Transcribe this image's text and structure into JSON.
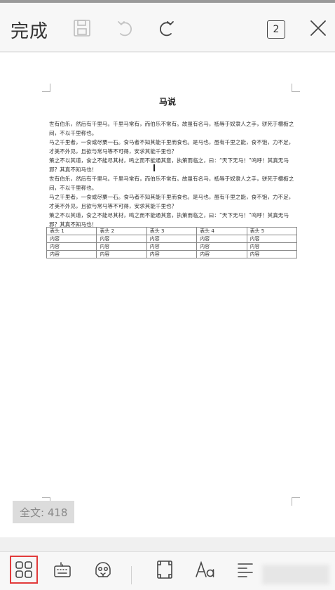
{
  "topbar": {
    "done_label": "完成",
    "page_count": "2",
    "icons": [
      "save-icon",
      "undo-icon",
      "redo-icon",
      "close-icon"
    ]
  },
  "document": {
    "title": "马说",
    "paragraphs": [
      "世有伯乐，然后有千里马。千里马常有，而伯乐不常有。故虽有名马，祗辱于奴隶人之手，骈死于槽枥之间，不以千里称也。",
      "马之千里者，一食或尽粟一石。食马者不知其能千里而食也。是马也，虽有千里之能，食不饱，力不足，才美不外见，且欲与常马等不可得，安求其能千里也？",
      "策之不以其道，食之不能尽其材，鸣之而不能通其意，执策而临之，曰：“天下无马！”呜呼！其真无马邪？其真不知马也！",
      " 世有伯乐，然后有千里马。千里马常有，而伯乐不常有。故虽有名马，祗辱于奴隶人之手，骈死于槽枥之间，不以千里称也。",
      "马之千里者，一食或尽粟一石。食马者不知其能千里而食也。是马也，虽有千里之能，食不饱，力不足，才美不外见，且欲与常马等不可得，安求其能千里也？",
      "策之不以其道，食之不能尽其材，鸣之而不能通其意，执策而临之，曰：“天下无马！”呜呼！其真无马邪？其真不知马也！"
    ],
    "table": {
      "headers": [
        "表头 1",
        "表头 2",
        "表头 3",
        "表头 4",
        "表头 5"
      ],
      "rows": [
        [
          "内容",
          "内容",
          "内容",
          "内容",
          "内容"
        ],
        [
          "内容",
          "内容",
          "内容",
          "内容",
          "内容"
        ],
        [
          "内容",
          "内容",
          "内容",
          "内容",
          "内容"
        ]
      ]
    }
  },
  "status": {
    "word_count": "全文: 418"
  },
  "bottombar": {
    "icons": [
      "layout-grid-icon",
      "keyboard-icon",
      "mascot-icon",
      "fullscreen-icon",
      "font-icon",
      "align-icon"
    ],
    "selected": "layout-grid-icon",
    "accent_color": "#e23b3b"
  }
}
